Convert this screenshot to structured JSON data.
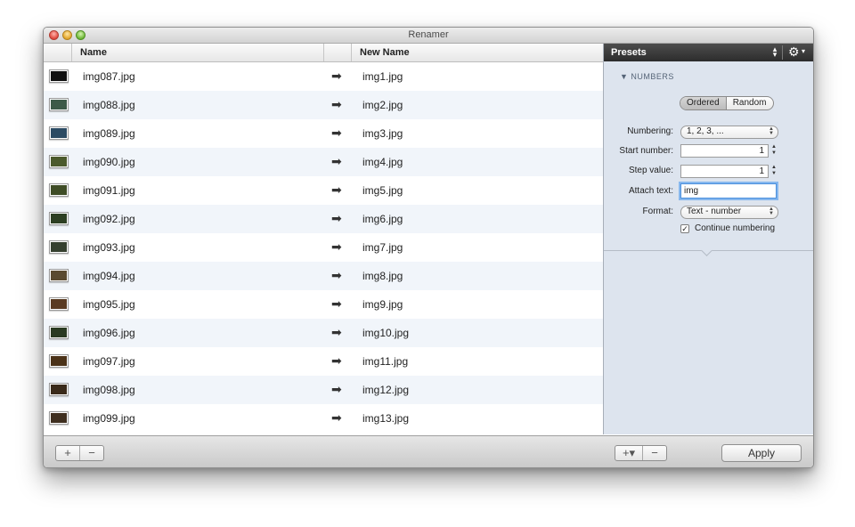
{
  "window": {
    "title": "Renamer"
  },
  "columns": {
    "name": "Name",
    "new_name": "New Name"
  },
  "rows": [
    {
      "name": "img087.jpg",
      "new_name": "img1.jpg"
    },
    {
      "name": "img088.jpg",
      "new_name": "img2.jpg"
    },
    {
      "name": "img089.jpg",
      "new_name": "img3.jpg"
    },
    {
      "name": "img090.jpg",
      "new_name": "img4.jpg"
    },
    {
      "name": "img091.jpg",
      "new_name": "img5.jpg"
    },
    {
      "name": "img092.jpg",
      "new_name": "img6.jpg"
    },
    {
      "name": "img093.jpg",
      "new_name": "img7.jpg"
    },
    {
      "name": "img094.jpg",
      "new_name": "img8.jpg"
    },
    {
      "name": "img095.jpg",
      "new_name": "img9.jpg"
    },
    {
      "name": "img096.jpg",
      "new_name": "img10.jpg"
    },
    {
      "name": "img097.jpg",
      "new_name": "img11.jpg"
    },
    {
      "name": "img098.jpg",
      "new_name": "img12.jpg"
    },
    {
      "name": "img099.jpg",
      "new_name": "img13.jpg"
    }
  ],
  "arrow_glyph": "➡",
  "presets": {
    "label": "Presets",
    "section": "▼ NUMBERS",
    "mode_options": [
      "Ordered",
      "Random"
    ],
    "numbering_label": "Numbering:",
    "numbering_value": "1, 2, 3, ...",
    "start_label": "Start number:",
    "start_value": "1",
    "step_label": "Step value:",
    "step_value": "1",
    "attach_label": "Attach text:",
    "attach_value": "img",
    "format_label": "Format:",
    "format_value": "Text - number",
    "continue_label": "Continue numbering",
    "continue_checked": "✓"
  },
  "footer": {
    "add": "+",
    "remove": "−",
    "add_menu": "+▾",
    "apply": "Apply"
  },
  "thumb_colors": [
    "#111111",
    "#3d5a48",
    "#2c4b63",
    "#4b5a2c",
    "#3f4d26",
    "#2d3f22",
    "#35402f",
    "#5a4a30",
    "#5a3b22",
    "#2a3a22",
    "#4b3218",
    "#3a2a1a",
    "#3f2f1f"
  ]
}
